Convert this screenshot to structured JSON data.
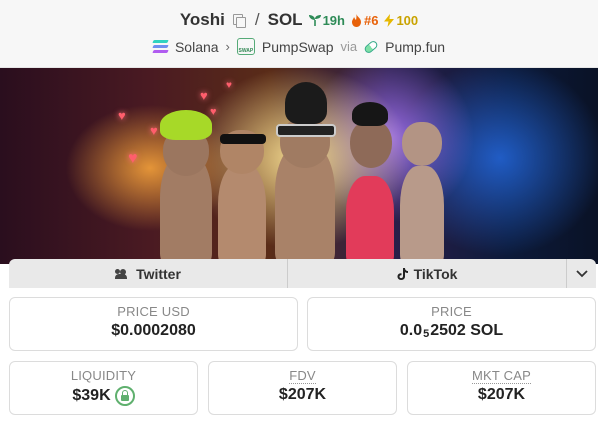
{
  "header": {
    "token_name": "Yoshi",
    "pair_base": "SOL",
    "age": "19h",
    "rank": "#6",
    "boost": "100",
    "chain": "Solana",
    "dex": "PumpSwap",
    "via_label": "via",
    "launchpad": "Pump.fun"
  },
  "social": {
    "twitter_label": "Twitter",
    "tiktok_label": "TikTok"
  },
  "stats": {
    "price_usd_label": "PRICE USD",
    "price_usd_value": "$0.0002080",
    "price_label": "PRICE",
    "price_prefix": "0.0",
    "price_zero_count": "5",
    "price_suffix": "2502 SOL",
    "liquidity_label": "LIQUIDITY",
    "liquidity_value": "$39K",
    "fdv_label": "FDV",
    "fdv_value": "$207K",
    "mktcap_label": "MKT CAP",
    "mktcap_value": "$207K"
  },
  "icons": {
    "copy": "copy-icon",
    "age": "sprout-icon",
    "rank": "flame-icon",
    "boost": "lightning-icon",
    "chain": "solana-logo-icon",
    "dex": "pumpswap-icon",
    "launchpad": "pill-icon",
    "twitter": "people-icon",
    "tiktok": "tiktok-icon",
    "expand": "chevron-down-icon",
    "locked": "lock-icon"
  },
  "colors": {
    "age": "#2e8b57",
    "rank": "#e8620a",
    "boost": "#c9a300",
    "lock": "#5fb06e"
  }
}
